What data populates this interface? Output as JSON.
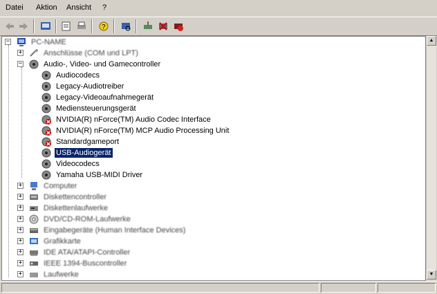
{
  "menu": [
    "Datei",
    "Aktion",
    "Ansicht",
    "?"
  ],
  "tree": {
    "root": "PC-NAME",
    "collapsed_above": [
      "Anschlüsse (COM und LPT)"
    ],
    "expanded_category": "Audio-, Video- und Gamecontroller",
    "children": [
      {
        "label": "Audiocodecs",
        "error": false
      },
      {
        "label": "Legacy-Audiotreiber",
        "error": false
      },
      {
        "label": "Legacy-Videoaufnahmegerät",
        "error": false
      },
      {
        "label": "Mediensteuerungsgerät",
        "error": false
      },
      {
        "label": "NVIDIA(R) nForce(TM) Audio Codec Interface",
        "error": true
      },
      {
        "label": "NVIDIA(R) nForce(TM) MCP Audio Processing Unit",
        "error": true
      },
      {
        "label": "Standardgameport",
        "error": true
      },
      {
        "label": "USB-Audiogerät",
        "error": false,
        "selected": true
      },
      {
        "label": "Videocodecs",
        "error": false
      },
      {
        "label": "Yamaha USB-MIDI Driver",
        "error": false
      }
    ],
    "collapsed_below": [
      "Computer",
      "Diskettencontroller",
      "Diskettenlaufwerke",
      "DVD/CD-ROM-Laufwerke",
      "Eingabegeräte (Human Interface Devices)",
      "Grafikkarte",
      "IDE ATA/ATAPI-Controller",
      "IEEE 1394-Buscontroller",
      "Laufwerke"
    ]
  }
}
